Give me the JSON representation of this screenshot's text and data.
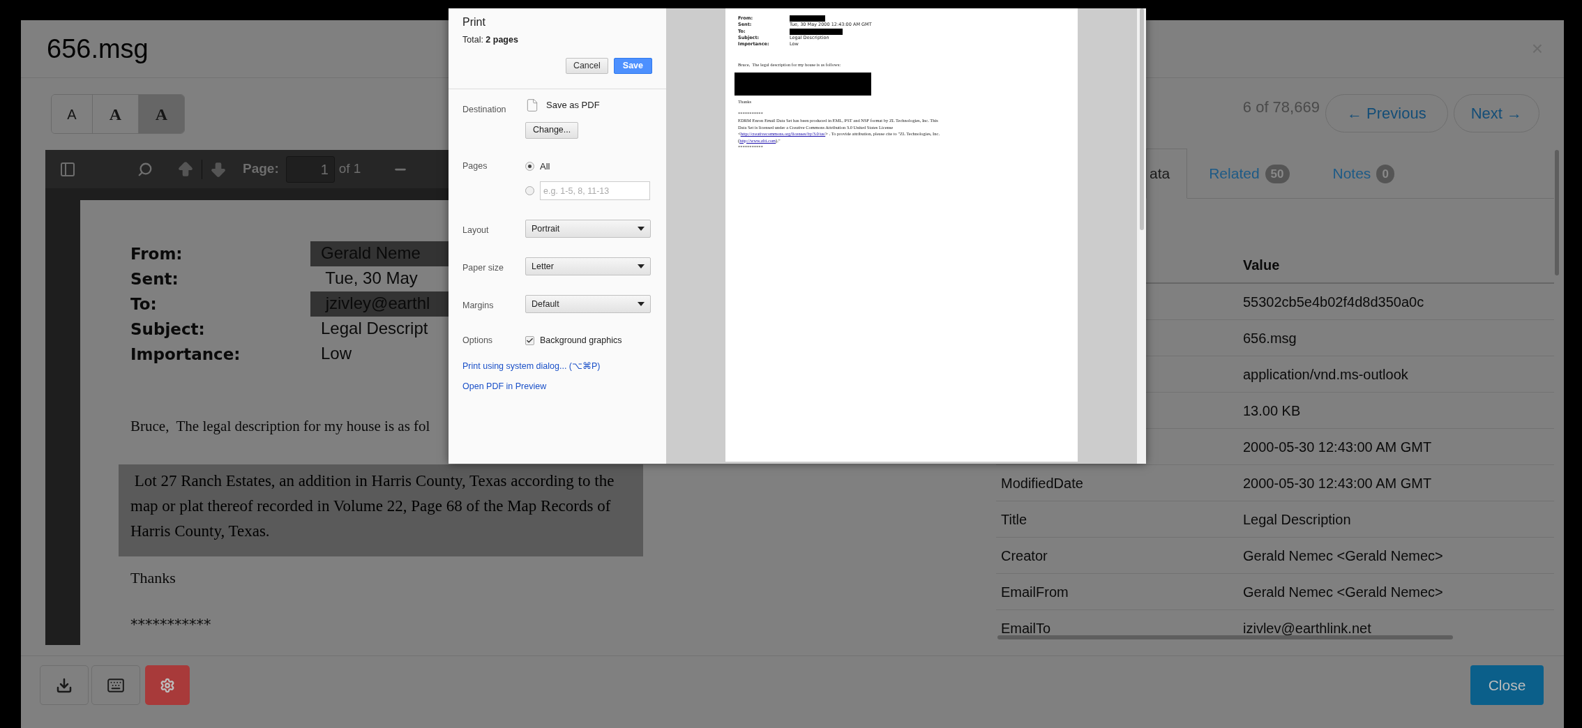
{
  "modal": {
    "title": "656.msg",
    "close": "×"
  },
  "font_size_buttons": [
    {
      "label": "A",
      "selected": false
    },
    {
      "label": "A",
      "selected": false
    },
    {
      "label": "A",
      "selected": true
    }
  ],
  "viewer_toolbar": {
    "page_label": "Page:",
    "page_value": "1",
    "page_count": "of 1"
  },
  "document": {
    "header": [
      {
        "label": "From:",
        "value": "Gerald Neme",
        "highlighted": true
      },
      {
        "label": "Sent:",
        "value": " Tue, 30 May",
        "highlighted": false
      },
      {
        "label": "To:",
        "value": " jzivley@earthl",
        "highlighted": true
      },
      {
        "label": "Subject:",
        "value": "Legal Descript",
        "highlighted": false
      },
      {
        "label": "Importance:",
        "value": "Low",
        "highlighted": false
      }
    ],
    "body": "Bruce,  The legal description for my house is as fol",
    "highlighted_paragraph": " Lot 27 Ranch Estates, an addition in Harris County, Texas according to the map or plat thereof recorded in Volume 22, Page 68 of the Map Records of Harris County, Texas.",
    "closing": "Thanks",
    "separator": "***********"
  },
  "pager": {
    "position": "6 of 78,669",
    "previous": "← Previous",
    "next": "Next →"
  },
  "tabs": [
    {
      "label": "ata",
      "selected": true
    },
    {
      "label": "Related",
      "count": "50",
      "selected": false
    },
    {
      "label": "Notes",
      "count": "0",
      "selected": false
    }
  ],
  "metadata_table": {
    "value_header": "Value",
    "rows": [
      {
        "value": "55302cb5e4b02f4d8d350a0c"
      },
      {
        "value": "656.msg"
      },
      {
        "value": "application/vnd.ms-outlook"
      },
      {
        "value": "13.00 KB"
      },
      {
        "value": "2000-05-30 12:43:00 AM GMT"
      },
      {
        "key": "ModifiedDate",
        "value": "2000-05-30 12:43:00 AM GMT"
      },
      {
        "key": "Title",
        "value": "Legal Description"
      },
      {
        "key": "Creator",
        "value": "Gerald Nemec <Gerald Nemec>"
      },
      {
        "key": "EmailFrom",
        "value": "Gerald Nemec <Gerald Nemec>"
      },
      {
        "key": "EmailTo",
        "value": "izivlev@earthlink.net"
      }
    ]
  },
  "footer": {
    "close": "Close"
  },
  "print_dialog": {
    "title": "Print",
    "total": "Total: **2 pages**",
    "buttons": [
      {
        "label": "Cancel",
        "kind": "secondary"
      },
      {
        "label": "Save",
        "kind": "primary"
      }
    ],
    "destination": {
      "label": "Destination",
      "value": "Save as PDF",
      "button": "Change..."
    },
    "pages": {
      "label": "Pages",
      "options": [
        {
          "label": "All",
          "selected": true
        },
        {
          "placeholder": "e.g. 1-5, 8, 11-13",
          "selected": false
        }
      ]
    },
    "selects": [
      {
        "label": "Layout",
        "value": "Portrait"
      },
      {
        "label": "Paper size",
        "value": "Letter"
      },
      {
        "label": "Margins",
        "value": "Default"
      }
    ],
    "options": {
      "label": "Options",
      "checkbox": "Background graphics",
      "checked": true
    },
    "links": [
      "Print using system dialog... (⌥⌘P)",
      "Open PDF in Preview"
    ]
  },
  "preview_page": {
    "header": [
      {
        "label": "From:",
        "redacted": true
      },
      {
        "label": "Sent:",
        "value": "Tue, 30 May 2000 12:43:00 AM GMT",
        "redacted": false
      },
      {
        "label": "To:",
        "redacted": true
      },
      {
        "label": "Subject:",
        "value": "Legal Description",
        "redacted": false
      },
      {
        "label": "Importance:",
        "value": "Low",
        "redacted": false
      }
    ],
    "body": "Bruce,  The legal description for my house is as follows:",
    "closing": "Thanks",
    "separator_top": "***********",
    "notice": [
      {
        "kind": "text",
        "text": "EDRM Enron Email Data Set has been produced in EML, PST and NSF format by ZL Technologies, Inc. This Data Set is licensed under a Creative Commons Attribution 3.0 United States License <"
      },
      {
        "kind": "link",
        "text": "http://creativecommons.org/licenses/by/3.0/us/"
      },
      {
        "kind": "text",
        "text": "> . To provide attribution, please cite to \"ZL Technologies, Inc. ("
      },
      {
        "kind": "link",
        "text": "http://www.zlti.com"
      },
      {
        "kind": "text",
        "text": ").\""
      }
    ],
    "separator_bottom": "***********"
  }
}
